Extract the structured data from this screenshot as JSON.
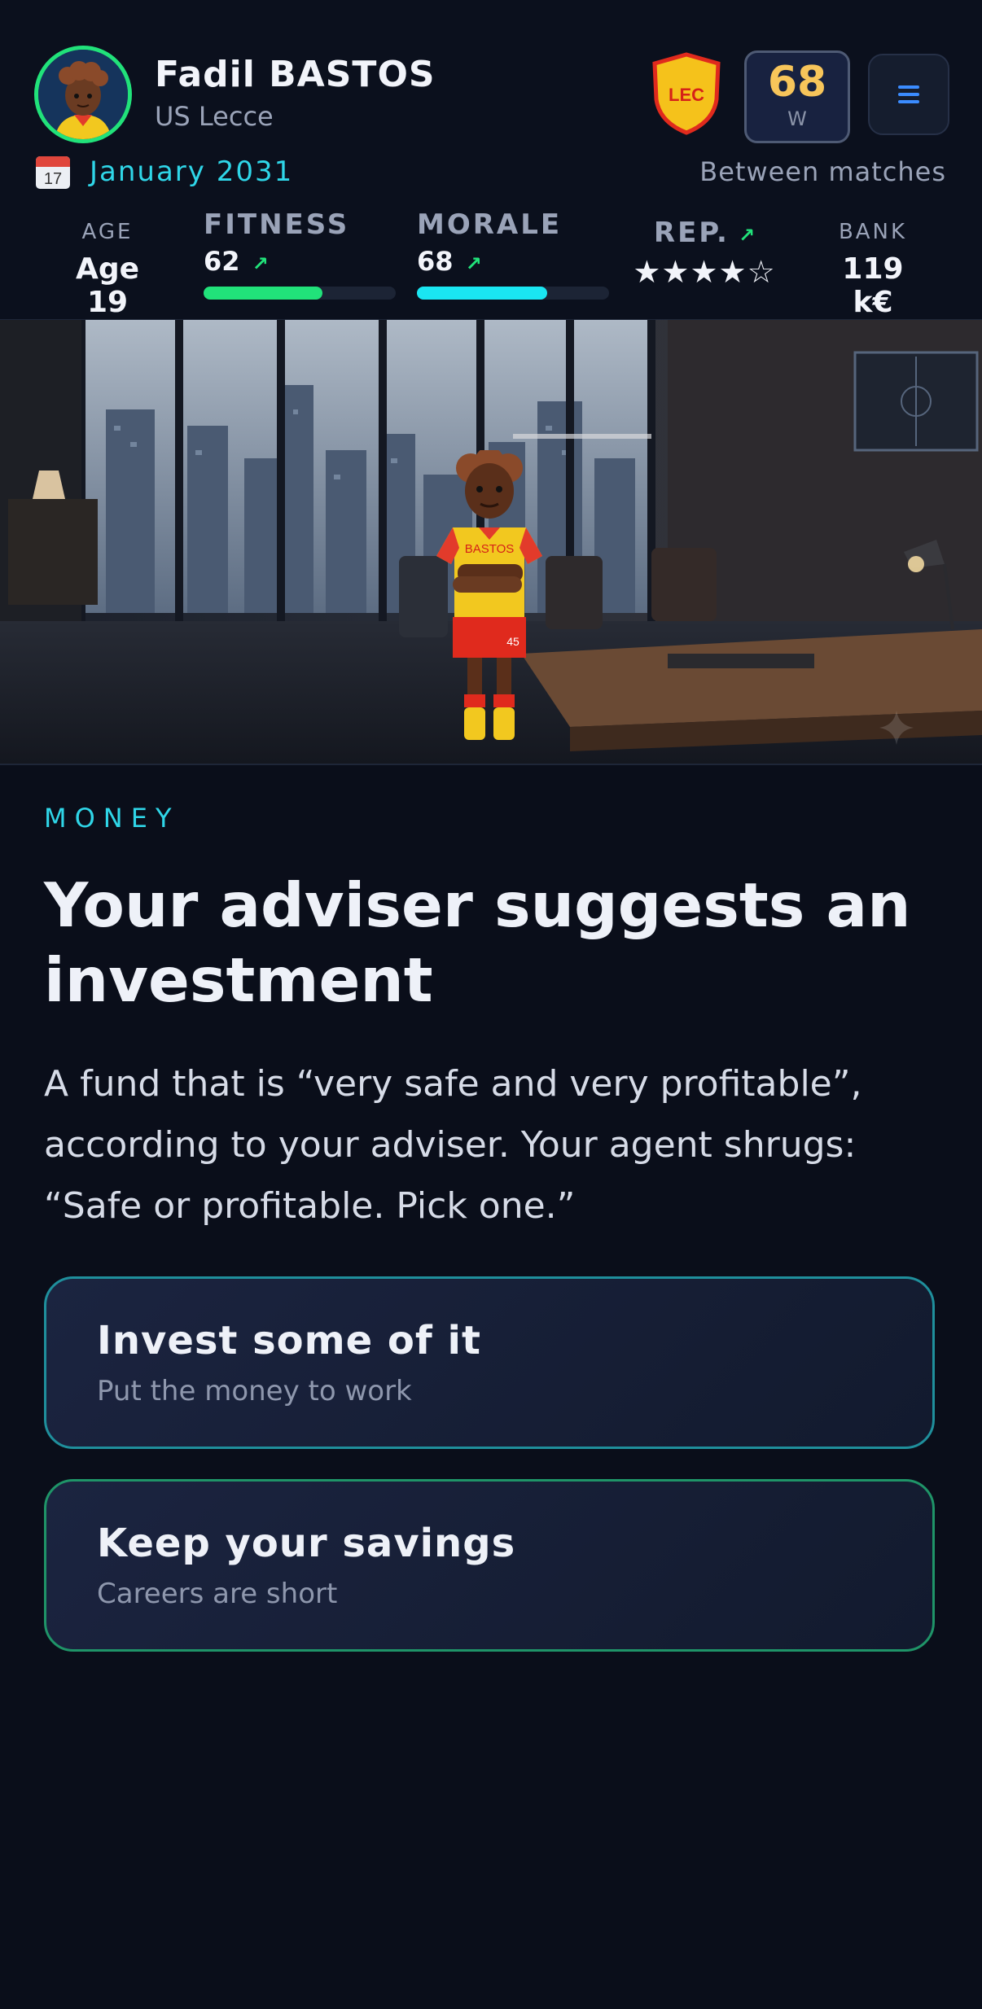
{
  "player": {
    "name": "Fadil BASTOS",
    "club": "US Lecce",
    "badge_text": "LEC",
    "rating": "68",
    "rating_label": "W"
  },
  "date": {
    "icon_text": "17",
    "label": "January 2031"
  },
  "status": "Between matches",
  "stats": {
    "age": {
      "label": "AGE",
      "value": "Age 19"
    },
    "fitness": {
      "label": "FITNESS",
      "value": "62",
      "arrow": "↗",
      "level": 0.62,
      "color": "#21e27a"
    },
    "morale": {
      "label": "MORALE",
      "value": "68",
      "arrow": "↗",
      "level": 0.68,
      "color": "#1ae6f2"
    },
    "reputation": {
      "label": "REP.",
      "arrow": "↗",
      "stars_filled": 4,
      "stars_total": 5,
      "stars": "★★★★☆"
    },
    "bank": {
      "label": "BANK",
      "value": "119 k€"
    }
  },
  "scene": {
    "shirt_name": "BASTOS",
    "shirt_number": "45"
  },
  "event": {
    "category": "MONEY",
    "title": "Your adviser suggests an investment",
    "description": "A fund that is “very safe and very profitable”, according to your adviser. Your agent shrugs: “Safe or profitable. Pick one.”"
  },
  "choices": [
    {
      "title": "Invest some of it",
      "subtitle": "Put the money to work"
    },
    {
      "title": "Keep your savings",
      "subtitle": "Careers are short"
    }
  ],
  "colors": {
    "accent": "#2fd6e8",
    "fitness": "#21e27a",
    "morale": "#1ae6f2",
    "rating": "#f7c55a",
    "background": "#0a0e1a"
  }
}
